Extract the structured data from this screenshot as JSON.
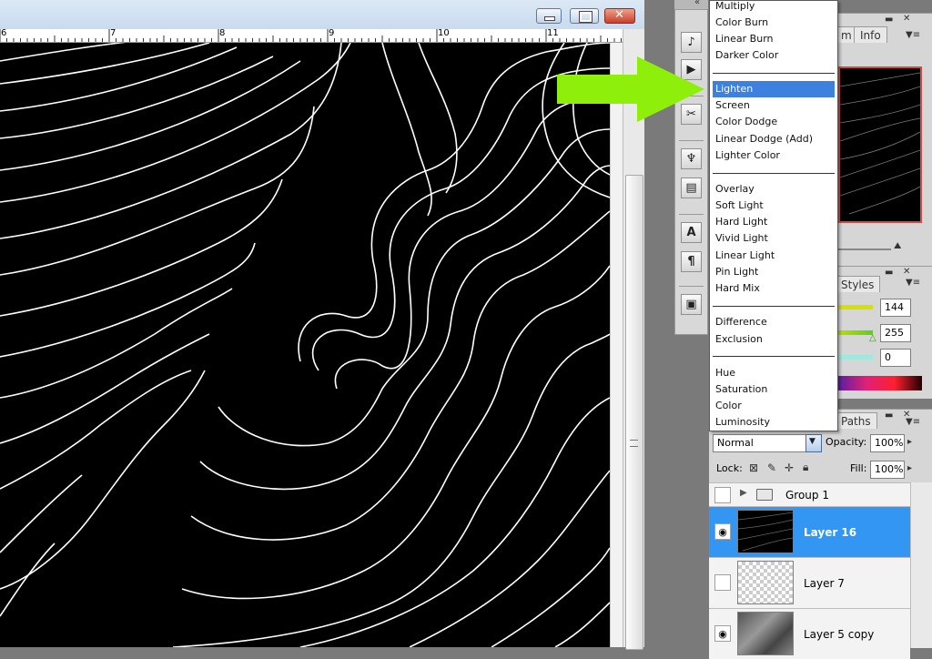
{
  "document": {
    "ruler_labels": [
      "6",
      "7",
      "8",
      "9",
      "10",
      "11"
    ]
  },
  "blend_menu": {
    "groups": [
      [
        "Multiply",
        "Color Burn",
        "Linear Burn",
        "Darker Color"
      ],
      [
        "Lighten",
        "Screen",
        "Color Dodge",
        "Linear Dodge (Add)",
        "Lighter Color"
      ],
      [
        "Overlay",
        "Soft Light",
        "Hard Light",
        "Vivid Light",
        "Linear Light",
        "Pin Light",
        "Hard Mix"
      ],
      [
        "Difference",
        "Exclusion"
      ],
      [
        "Hue",
        "Saturation",
        "Color",
        "Luminosity"
      ]
    ],
    "selected": "Lighten"
  },
  "navigator_panel": {
    "tabs": [
      "m",
      "Info"
    ]
  },
  "color_panel": {
    "tab": "Styles",
    "values": [
      "144",
      "255",
      "0"
    ]
  },
  "layers_panel": {
    "tab": "Paths",
    "blend_mode": "Normal",
    "opacity_label": "Opacity:",
    "opacity_value": "100%",
    "lock_label": "Lock:",
    "fill_label": "Fill:",
    "fill_value": "100%",
    "layers": [
      {
        "name": "Group 1",
        "type": "group",
        "visible": false,
        "selected": false
      },
      {
        "name": "Layer 16",
        "type": "layer",
        "visible": true,
        "selected": true
      },
      {
        "name": "Layer 7",
        "type": "layer",
        "visible": false,
        "selected": false
      },
      {
        "name": "Layer 5 copy",
        "type": "layer",
        "visible": true,
        "selected": false
      }
    ]
  },
  "colors": {
    "highlight": "#3d80df",
    "layer_selected": "#3396f3",
    "arrow": "#8ef00a",
    "canvas": "#000000"
  }
}
